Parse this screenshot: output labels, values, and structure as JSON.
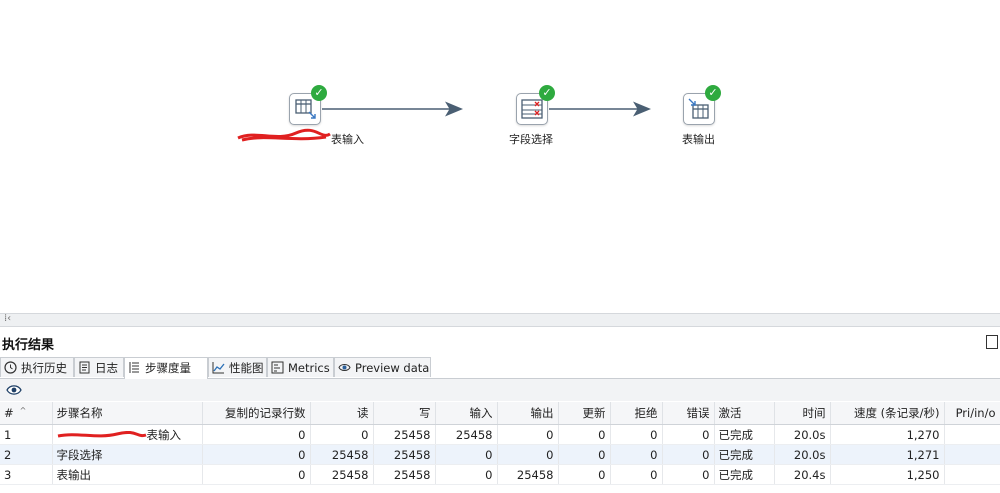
{
  "canvas": {
    "steps": [
      {
        "label": "表输入",
        "icon": "table-input-icon"
      },
      {
        "label": "字段选择",
        "icon": "select-values-icon"
      },
      {
        "label": "表输出",
        "icon": "table-output-icon"
      }
    ],
    "status_icon": "check-circle-icon"
  },
  "results": {
    "title": "执行结果",
    "tabs": [
      {
        "label": "执行历史",
        "icon": "clock-icon"
      },
      {
        "label": "日志",
        "icon": "log-icon"
      },
      {
        "label": "步骤度量",
        "icon": "step-metrics-icon"
      },
      {
        "label": "性能图",
        "icon": "chart-icon"
      },
      {
        "label": "Metrics",
        "icon": "metrics-icon"
      },
      {
        "label": "Preview data",
        "icon": "eye-icon"
      }
    ],
    "active_tab": "步骤度量"
  },
  "table": {
    "columns": [
      "#",
      "步骤名称",
      "复制的记录行数",
      "读",
      "写",
      "输入",
      "输出",
      "更新",
      "拒绝",
      "错误",
      "激活",
      "时间",
      "速度 (条记录/秒)",
      "Pri/in/o"
    ],
    "rows": [
      {
        "num": "1",
        "name": "表输入",
        "copied": "0",
        "read": "0",
        "written": "25458",
        "input": "25458",
        "output": "0",
        "updated": "0",
        "rejected": "0",
        "errors": "0",
        "active": "已完成",
        "time": "20.0s",
        "speed": "1,270",
        "pri": ""
      },
      {
        "num": "2",
        "name": "字段选择",
        "copied": "0",
        "read": "25458",
        "written": "25458",
        "input": "0",
        "output": "0",
        "updated": "0",
        "rejected": "0",
        "errors": "0",
        "active": "已完成",
        "time": "20.0s",
        "speed": "1,271",
        "pri": ""
      },
      {
        "num": "3",
        "name": "表输出",
        "copied": "0",
        "read": "25458",
        "written": "25458",
        "input": "0",
        "output": "25458",
        "updated": "0",
        "rejected": "0",
        "errors": "0",
        "active": "已完成",
        "time": "20.4s",
        "speed": "1,250",
        "pri": ""
      }
    ]
  },
  "colors": {
    "success": "#2eaa3f",
    "hop": "#4a5f73",
    "redaction": "#e02020",
    "row_alt": "#edf3fb"
  }
}
